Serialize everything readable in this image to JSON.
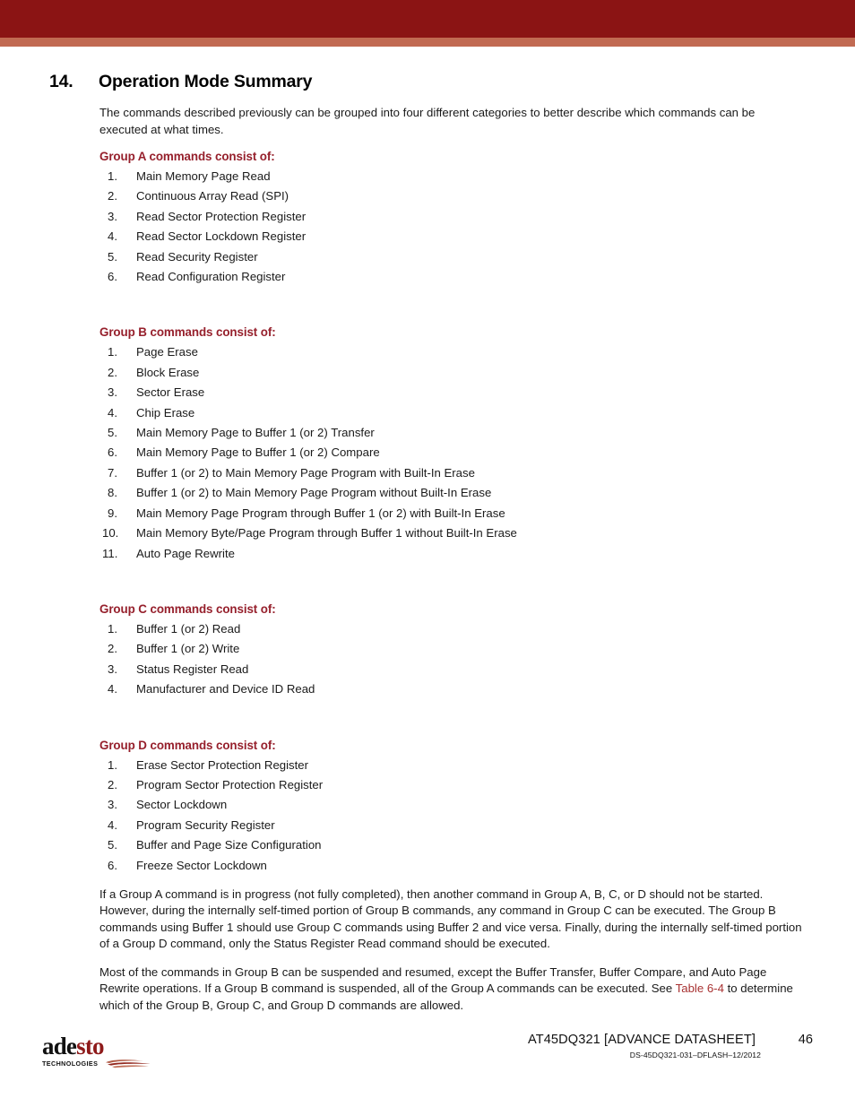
{
  "header": {
    "band_color": "#8B1414",
    "stripe_color": "#C16A52"
  },
  "section": {
    "number": "14.",
    "title": "Operation Mode Summary"
  },
  "intro_paragraph": "The commands described previously can be grouped into four different categories to better describe which commands can be executed at what times.",
  "groups": [
    {
      "heading": "Group A commands consist of:",
      "items": [
        "Main Memory Page Read",
        "Continuous Array Read (SPI)",
        "Read Sector Protection Register",
        "Read Sector Lockdown Register",
        "Read Security Register",
        "Read Configuration Register"
      ]
    },
    {
      "heading": "Group B commands consist of:",
      "items": [
        "Page Erase",
        "Block Erase",
        "Sector Erase",
        "Chip Erase",
        "Main Memory Page to Buffer 1 (or 2) Transfer",
        "Main Memory Page to Buffer 1 (or 2) Compare",
        "Buffer 1 (or 2) to Main Memory Page Program with Built-In Erase",
        "Buffer 1 (or 2) to Main Memory Page Program without Built-In Erase",
        "Main Memory Page Program through Buffer 1 (or 2) with Built-In Erase",
        "Main Memory Byte/Page Program through Buffer 1 without Built-In Erase",
        "Auto Page Rewrite"
      ]
    },
    {
      "heading": "Group C commands consist of:",
      "items": [
        "Buffer 1 (or 2) Read",
        "Buffer 1 (or 2) Write",
        "Status Register Read",
        "Manufacturer and Device ID Read"
      ]
    },
    {
      "heading": "Group D commands consist of:",
      "items": [
        "Erase Sector Protection Register",
        "Program Sector Protection Register",
        "Sector Lockdown",
        "Program Security Register",
        "Buffer and Page Size Configuration",
        "Freeze Sector Lockdown"
      ]
    }
  ],
  "closing_paragraph_1": "If a Group A command is in progress (not fully completed), then another command in Group A, B, C, or D should not be started. However, during the internally self-timed portion of Group B commands, any command in Group C can be executed. The Group B commands using Buffer 1 should use Group C commands using Buffer 2 and vice versa. Finally, during the internally self-timed portion of a Group D command, only the Status Register Read command should be executed.",
  "closing_paragraph_2": {
    "before_link": "Most of the commands in Group B can be suspended and resumed, except the Buffer Transfer, Buffer Compare, and Auto Page Rewrite operations. If a Group B command is suspended, all of the Group A commands can be executed. See ",
    "link_text": "Table 6-4",
    "after_link": " to determine which of the Group B, Group C, and Group D commands are allowed."
  },
  "footer": {
    "logo_text_dark": "ade",
    "logo_text_red": "sto",
    "logo_tagline": "TECHNOLOGIES",
    "document_title": "AT45DQ321 [ADVANCE DATASHEET]",
    "page_number": "46",
    "document_id": "DS-45DQ321-031–DFLASH–12/2012",
    "link_color": "#A83232",
    "heading_color": "#96202C"
  }
}
